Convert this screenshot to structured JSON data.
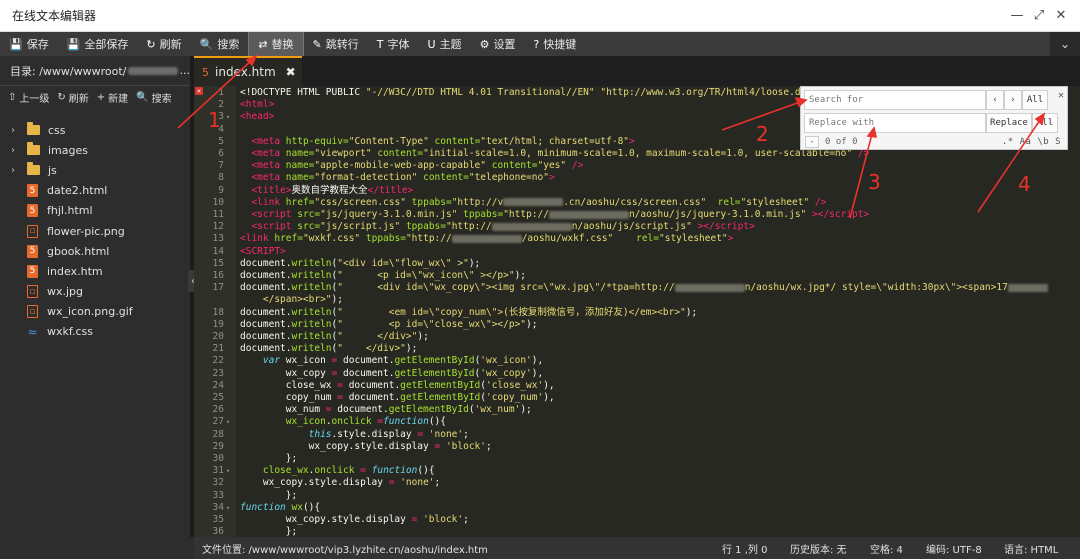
{
  "window": {
    "title": "在线文本编辑器",
    "controls": {
      "minimize": "—",
      "restore": "⤢",
      "close": "✕"
    }
  },
  "menu": {
    "items": [
      {
        "label": "保存",
        "icon": "💾"
      },
      {
        "label": "全部保存",
        "icon": "💾"
      },
      {
        "label": "刷新",
        "icon": "↻"
      },
      {
        "label": "搜索",
        "icon": "🔍"
      },
      {
        "label": "替换",
        "icon": "⇄"
      },
      {
        "label": "跳转行",
        "icon": "✎"
      },
      {
        "label": "字体",
        "icon": "T"
      },
      {
        "label": "主题",
        "icon": "U"
      },
      {
        "label": "设置",
        "icon": "⚙"
      },
      {
        "label": "快捷键",
        "icon": "?"
      }
    ],
    "collapse_icon": "⌄"
  },
  "sidebar": {
    "dir_label": "目录: /www/wwwroot/",
    "dir_suffix": "...",
    "tools": [
      {
        "label": "上一级",
        "icon": "⇧"
      },
      {
        "label": "刷新",
        "icon": "↻"
      },
      {
        "label": "新建",
        "icon": "+"
      },
      {
        "label": "搜索",
        "icon": "🔍"
      }
    ],
    "folders": [
      "css",
      "images",
      "js"
    ],
    "files": [
      {
        "name": "date2.html",
        "type": "html"
      },
      {
        "name": "fhjl.html",
        "type": "html"
      },
      {
        "name": "flower-pic.png",
        "type": "img"
      },
      {
        "name": "gbook.html",
        "type": "html"
      },
      {
        "name": "index.htm",
        "type": "html"
      },
      {
        "name": "wx.jpg",
        "type": "img"
      },
      {
        "name": "wx_icon.png.gif",
        "type": "img"
      },
      {
        "name": "wxkf.css",
        "type": "css"
      }
    ],
    "collapse_handle": "‹"
  },
  "tab": {
    "name": "index.htm",
    "icon": "5",
    "close": "✖"
  },
  "editor": {
    "lines": [
      {
        "n": "1",
        "fold": "",
        "html": "&lt;!DOCTYPE HTML PUBLIC <span class='s'>\"-//W3C//DTD HTML 4.01 Transitional//EN\"</span> <span class='s'>\"http://www.w3.org/TR/html4/loose.dtd\"</span>"
      },
      {
        "n": "2",
        "fold": "",
        "html": "<span class='t'>&lt;html&gt;</span>"
      },
      {
        "n": "3",
        "fold": "▾",
        "html": "<span class='t'>&lt;head&gt;</span>"
      },
      {
        "n": "4",
        "fold": "",
        "html": ""
      },
      {
        "n": "5",
        "fold": "",
        "html": "  <span class='t'>&lt;meta</span> <span class='a'>http-equiv=</span><span class='s'>\"Content-Type\"</span> <span class='a'>content=</span><span class='s'>\"text/html; charset=utf-8\"</span><span class='t'>&gt;</span>"
      },
      {
        "n": "6",
        "fold": "",
        "html": "  <span class='t'>&lt;meta</span> <span class='a'>name=</span><span class='s'>\"viewport\"</span> <span class='a'>content=</span><span class='s'>\"initial-scale=1.0, minimum-scale=1.0, maximum-scale=1.0, user-scalable=no\"</span> <span class='t'>/&gt;</span>"
      },
      {
        "n": "7",
        "fold": "",
        "html": "  <span class='t'>&lt;meta</span> <span class='a'>name=</span><span class='s'>\"apple-mobile-web-app-capable\"</span> <span class='a'>content=</span><span class='s'>\"yes\"</span> <span class='t'>/&gt;</span>"
      },
      {
        "n": "8",
        "fold": "",
        "html": "  <span class='t'>&lt;meta</span> <span class='a'>name=</span><span class='s'>\"format-detection\"</span> <span class='a'>content=</span><span class='s'>\"telephone=no\"</span><span class='t'>&gt;</span>"
      },
      {
        "n": "9",
        "fold": "",
        "html": "  <span class='t'>&lt;title&gt;</span>奥数自学教程大全<span class='t'>&lt;/title&gt;</span>"
      },
      {
        "n": "10",
        "fold": "",
        "html": "  <span class='t'>&lt;link</span> <span class='a'>href=</span><span class='s'>\"css/screen.css\"</span> <span class='a'>tppabs=</span><span class='s'>\"http://v<span class='blurc' style='width:60px'></span>.cn/aoshu/css/screen.css\"</span>  <span class='a'>rel=</span><span class='s'>\"stylesheet\"</span> <span class='t'>/&gt;</span>"
      },
      {
        "n": "11",
        "fold": "",
        "html": "  <span class='t'>&lt;script</span> <span class='a'>src=</span><span class='s'>\"js/jquery-3.1.0.min.js\"</span> <span class='a'>tppabs=</span><span class='s'>\"http://<span class='blurc' style='width:80px'></span>n/aoshu/js/jquery-3.1.0.min.js\"</span> <span class='t'>&gt;&lt;/script&gt;</span>"
      },
      {
        "n": "12",
        "fold": "",
        "html": "  <span class='t'>&lt;script</span> <span class='a'>src=</span><span class='s'>\"js/script.js\"</span> <span class='a'>tppabs=</span><span class='s'>\"http://<span class='blurc' style='width:80px'></span>n/aoshu/js/script.js\"</span> <span class='t'>&gt;&lt;/script&gt;</span>"
      },
      {
        "n": "13",
        "fold": "",
        "html": "<span class='t'>&lt;link</span> <span class='a'>href=</span><span class='s'>\"wxkf.css\"</span> <span class='a'>tppabs=</span><span class='s'>\"http://<span class='blurc' style='width:70px'></span>/aoshu/wxkf.css\"</span>    <span class='a'>rel=</span><span class='s'>\"stylesheet\"</span><span class='t'>&gt;</span>"
      },
      {
        "n": "14",
        "fold": "",
        "html": "<span class='t'>&lt;SCRIPT&gt;</span>"
      },
      {
        "n": "15",
        "fold": "",
        "html": "document.<span class='f'>writeln</span>(<span class='s'>\"&lt;div id=\\\"flow_wx\\\" &gt;\"</span>);"
      },
      {
        "n": "16",
        "fold": "",
        "html": "document.<span class='f'>writeln</span>(<span class='s'>\"      &lt;p id=\\\"wx_icon\\\" &gt;&lt;/p&gt;\"</span>);"
      },
      {
        "n": "17",
        "fold": "",
        "html": "document.<span class='f'>writeln</span>(<span class='s'>\"      &lt;div id=\\\"wx_copy\\\"&gt;&lt;img src=\\\"wx.jpg\\\"/*tpa=http://<span class='blurc' style='width:70px'></span>n/aoshu/wx.jpg*/ style=\\\"width:30px\\\"&gt;&lt;span&gt;17<span class='blurc' style='width:40px'></span></span>"
      },
      {
        "n": "",
        "fold": "",
        "html": "<span class='s'>    &lt;/span&gt;&lt;br&gt;\"</span>);"
      },
      {
        "n": "18",
        "fold": "",
        "html": "document.<span class='f'>writeln</span>(<span class='s'>\"        &lt;em id=\\\"copy_num\\\"&gt;(长按复制微信号，添加好友)&lt;/em&gt;&lt;br&gt;\"</span>);"
      },
      {
        "n": "19",
        "fold": "",
        "html": "document.<span class='f'>writeln</span>(<span class='s'>\"        &lt;p id=\\\"close_wx\\\"&gt;&lt;/p&gt;\"</span>);"
      },
      {
        "n": "20",
        "fold": "",
        "html": "document.<span class='f'>writeln</span>(<span class='s'>\"      &lt;/div&gt;\"</span>);"
      },
      {
        "n": "21",
        "fold": "",
        "html": "document.<span class='f'>writeln</span>(<span class='s'>\"    &lt;/div&gt;\"</span>);"
      },
      {
        "n": "22",
        "fold": "",
        "html": "    <span class='k'>var</span> wx_icon <span class='t'>=</span> document.<span class='f'>getElementById</span>(<span class='s'>'wx_icon'</span>),"
      },
      {
        "n": "23",
        "fold": "",
        "html": "        wx_copy <span class='t'>=</span> document.<span class='f'>getElementById</span>(<span class='s'>'wx_copy'</span>),"
      },
      {
        "n": "24",
        "fold": "",
        "html": "        close_wx <span class='t'>=</span> document.<span class='f'>getElementById</span>(<span class='s'>'close_wx'</span>),"
      },
      {
        "n": "25",
        "fold": "",
        "html": "        copy_num <span class='t'>=</span> document.<span class='f'>getElementById</span>(<span class='s'>'copy_num'</span>),"
      },
      {
        "n": "26",
        "fold": "",
        "html": "        wx_num <span class='t'>=</span> document.<span class='f'>getElementById</span>(<span class='s'>'wx_num'</span>);"
      },
      {
        "n": "27",
        "fold": "▾",
        "html": "        <span class='f'>wx_icon</span>.<span class='f'>onclick</span> <span class='t'>=</span><span class='k'>function</span>(){"
      },
      {
        "n": "28",
        "fold": "",
        "html": "            <span class='k'>this</span>.style.display <span class='t'>=</span> <span class='s'>'none'</span>;"
      },
      {
        "n": "29",
        "fold": "",
        "html": "            wx_copy.style.display <span class='t'>=</span> <span class='s'>'block'</span>;"
      },
      {
        "n": "30",
        "fold": "",
        "html": "        };"
      },
      {
        "n": "31",
        "fold": "▾",
        "html": "    <span class='f'>close_wx</span>.<span class='f'>onclick</span> <span class='t'>=</span> <span class='k'>function</span>(){"
      },
      {
        "n": "32",
        "fold": "",
        "html": "    wx_copy.style.display <span class='t'>=</span> <span class='s'>'none'</span>;"
      },
      {
        "n": "33",
        "fold": "",
        "html": "        };"
      },
      {
        "n": "34",
        "fold": "▾",
        "html": "<span class='k'>function</span> <span class='f'>wx</span>(){"
      },
      {
        "n": "35",
        "fold": "",
        "html": "        wx_copy.style.display <span class='t'>=</span> <span class='s'>'block'</span>;"
      },
      {
        "n": "36",
        "fold": "",
        "html": "        };"
      }
    ],
    "error_marker": "✕"
  },
  "search_replace": {
    "search_placeholder": "Search for",
    "replace_placeholder": "Replace with",
    "prev": "‹",
    "next": "›",
    "all_find": "All",
    "replace": "Replace",
    "all_replace": "All",
    "close": "✕",
    "counter": "0 of 0",
    "minus": "-",
    "options": ".* Aa \\b S"
  },
  "status": {
    "path": "文件位置: /www/wwwroot/vip3.lyzhite.cn/aoshu/index.htm",
    "position": "行 1 ,列 0",
    "history": "历史版本: 无",
    "indent": "空格: 4",
    "encoding": "编码: UTF-8",
    "language": "语言: HTML"
  },
  "annotations": [
    "1",
    "2",
    "3",
    "4"
  ],
  "colors": {
    "accent": "#f39c12",
    "annotation": "#e8322a",
    "editor_bg": "#272822"
  }
}
